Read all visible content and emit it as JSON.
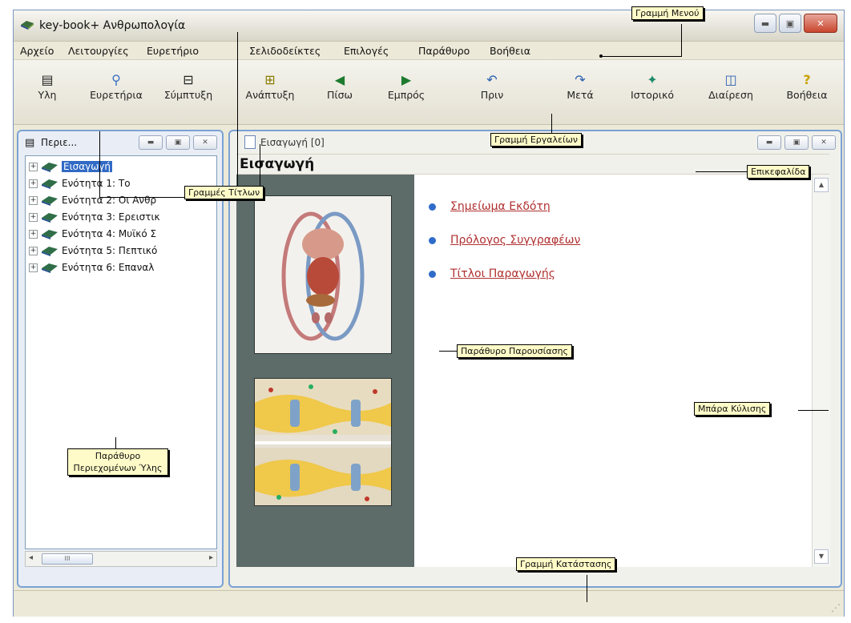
{
  "window": {
    "title": "key-book+   Ανθρωπολογία",
    "buttons": {
      "minimize": "▬",
      "maximize": "▣",
      "close": "✕"
    }
  },
  "menu": [
    "Αρχείο",
    "Λειτουργίες",
    "Ευρετήριο",
    "Σελιδοδείκτες",
    "Επιλογές",
    "Παράθυρο",
    "Βοήθεια"
  ],
  "toolbar": [
    {
      "label": "Υλη",
      "icon": "content-icon"
    },
    {
      "label": "Ευρετήρια",
      "icon": "magnifier-icon"
    },
    {
      "label": "Σύμπτυξη",
      "icon": "collapse-icon"
    },
    {
      "label": "Ανάπτυξη",
      "icon": "expand-icon"
    },
    {
      "label": "Πίσω",
      "icon": "back-arrow-icon"
    },
    {
      "label": "Εμπρός",
      "icon": "forward-arrow-icon"
    },
    {
      "label": "Πριν",
      "icon": "undo-icon"
    },
    {
      "label": "Μετά",
      "icon": "redo-icon"
    },
    {
      "label": "Ιστορικό",
      "icon": "history-icon"
    },
    {
      "label": "Διαίρεση",
      "icon": "split-icon"
    },
    {
      "label": "Βοήθεια",
      "icon": "help-icon"
    }
  ],
  "contents_panel": {
    "title": "Περιε...",
    "items": [
      {
        "label": "Εισαγωγή",
        "selected": true
      },
      {
        "label": "Ενότητα   1:  Το"
      },
      {
        "label": "Ενότητα   2:  Οι Ανθρ"
      },
      {
        "label": "Ενότητα   3:  Ερειστικ"
      },
      {
        "label": "Ενότητα   4:  Μυϊκό Σ"
      },
      {
        "label": "Ενότητα   5:  Πεπτικό"
      },
      {
        "label": "Ενότητα   6:  Επαναλ"
      }
    ],
    "scroll_thumb": "III"
  },
  "presentation_panel": {
    "tab_title": "Εισαγωγή   [0]",
    "heading": "Εισαγωγή",
    "links": [
      "Σημείωμα Εκδότη",
      "Πρόλογος Συγγραφέων",
      "Τίτλοι Παραγωγής"
    ]
  },
  "callouts": {
    "menu_bar": "Γραμμή Μενού",
    "toolbar": "Γραμμή Εργαλείων",
    "title_bars": "Γραμμές Τίτλων",
    "heading": "Επικεφαλίδα",
    "presentation_window": "Παράθυρο Παρουσίασης",
    "scrollbar": "Μπάρα Κύλισης",
    "contents_window": "Παράθυρο Περιεχομένων Ύλης",
    "status_bar": "Γραμμή Κατάστασης"
  }
}
